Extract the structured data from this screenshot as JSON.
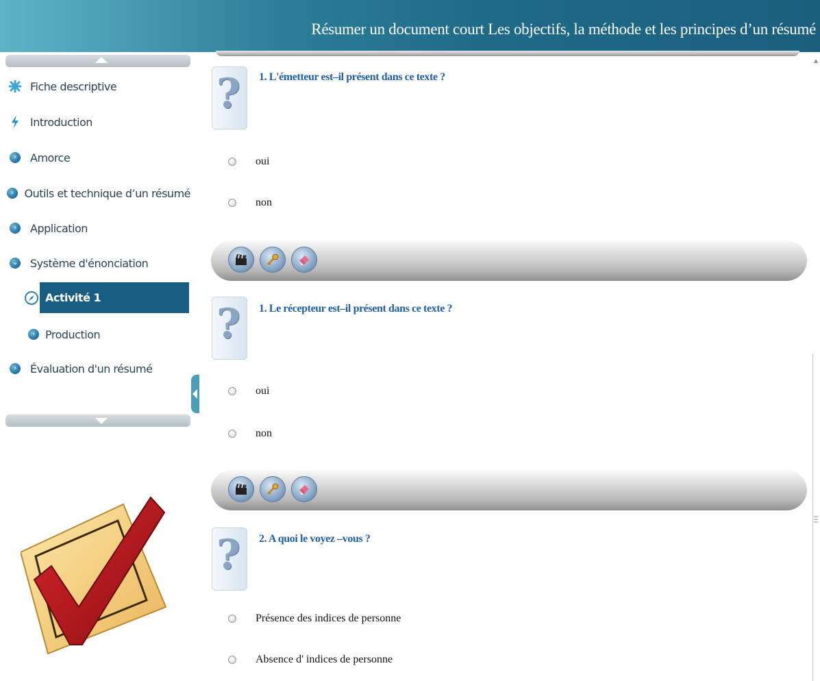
{
  "header": {
    "title": "Résumer un document court Les objectifs, la méthode et les principes d’un résumé"
  },
  "sidebar": {
    "items": [
      {
        "label": "Fiche descriptive",
        "icon": "asterisk-icon"
      },
      {
        "label": "Introduction",
        "icon": "lightning-icon"
      },
      {
        "label": "Amorce",
        "icon": "chevron-bullet-icon"
      },
      {
        "label": "Outils et technique d’un résumé",
        "icon": "chevron-bullet-icon"
      },
      {
        "label": "Application",
        "icon": "chevron-bullet-icon"
      },
      {
        "label": "Système d'énonciation",
        "icon": "chevron-down-bullet-icon"
      },
      {
        "label": "Activité 1",
        "icon": "compass-icon",
        "active": true
      },
      {
        "label": "Production",
        "icon": "chevron-bullet-icon"
      },
      {
        "label": "Évaluation d'un résumé",
        "icon": "chevron-bullet-icon"
      }
    ]
  },
  "questions": [
    {
      "text": "1. L'émetteur est–il présent dans ce texte ?",
      "options": [
        "oui",
        "non"
      ]
    },
    {
      "text": "1. Le récepteur est–il présent dans ce texte ?",
      "options": [
        "oui",
        "non"
      ]
    },
    {
      "text": "2. A quoi le voyez –vous ?",
      "options": [
        "Présence des indices de personne",
        "Absence d' indices de personne"
      ]
    }
  ],
  "toolbar_buttons": [
    "clapperboard-icon",
    "key-icon",
    "eraser-icon"
  ],
  "colors": {
    "header": "#1e6a88",
    "active_item": "#175e82",
    "question_text": "#1f5fa8"
  }
}
